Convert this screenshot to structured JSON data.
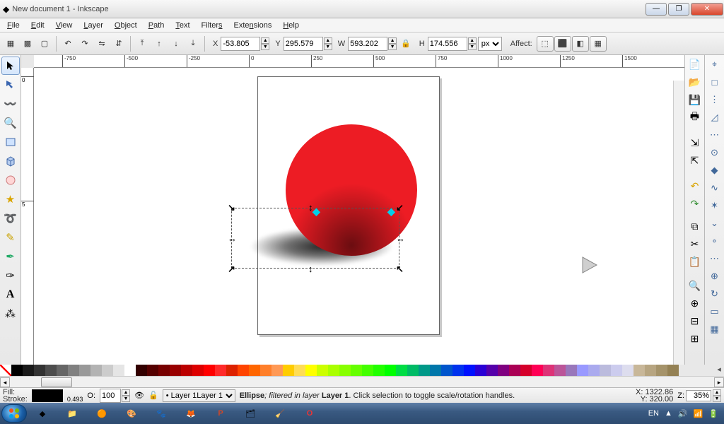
{
  "window": {
    "title": "New document 1 - Inkscape"
  },
  "menu": {
    "file": "File",
    "edit": "Edit",
    "view": "View",
    "layer": "Layer",
    "object": "Object",
    "path": "Path",
    "text": "Text",
    "filters": "Filters",
    "extensions": "Extensions",
    "help": "Help"
  },
  "options": {
    "X_label": "X",
    "X": "-53.805",
    "Y_label": "Y",
    "Y": "295.579",
    "W_label": "W",
    "W": "593.202",
    "H_label": "H",
    "H": "174.556",
    "units": "px",
    "affect_label": "Affect:"
  },
  "ruler": {
    "h": [
      "-750",
      "-500",
      "-250",
      "0",
      "250",
      "500",
      "750",
      "1000",
      "1250",
      "1500"
    ],
    "v": [
      "0",
      "5"
    ]
  },
  "palette_colors": [
    "#000000",
    "#1a1a1a",
    "#333333",
    "#4d4d4d",
    "#666666",
    "#808080",
    "#999999",
    "#b3b3b3",
    "#cccccc",
    "#e5e5e5",
    "#ffffff",
    "#330000",
    "#550000",
    "#770000",
    "#990000",
    "#bb0000",
    "#dd0000",
    "#ff0000",
    "#ff2a2a",
    "#dd2200",
    "#ff4400",
    "#ff6600",
    "#ff7f2a",
    "#ff9955",
    "#ffcc00",
    "#ffdd55",
    "#ffff00",
    "#ccff00",
    "#aaff00",
    "#88ff00",
    "#66ff00",
    "#44ff00",
    "#22ff00",
    "#00ff00",
    "#00dd44",
    "#00bb66",
    "#009988",
    "#0077aa",
    "#0055cc",
    "#0033ee",
    "#0011ff",
    "#2a00d5",
    "#5500aa",
    "#7f0080",
    "#aa0055",
    "#d5002b",
    "#ff0055",
    "#dd3377",
    "#bb5599",
    "#9977bb",
    "#9999ff",
    "#aaaaee",
    "#bbbbdd",
    "#ccccee",
    "#ddddee",
    "#c8b799",
    "#b7a581",
    "#a5936a",
    "#948154"
  ],
  "status": {
    "fill_label": "Fill:",
    "stroke_label": "Stroke:",
    "stroke_val": "0.493",
    "O_label": "O:",
    "opacity": "100",
    "layer": "Layer 1",
    "desc_prefix": "Ellipse",
    "desc_mid": "; filtered in layer ",
    "desc_layer": "Layer 1",
    "desc_suffix": ". Click selection to toggle scale/rotation handles.",
    "cursor_x": "X: 1322.86",
    "cursor_y": "Y:  320.00",
    "Z_label": "Z:",
    "zoom": "35%"
  },
  "tray": {
    "lang": "EN"
  }
}
